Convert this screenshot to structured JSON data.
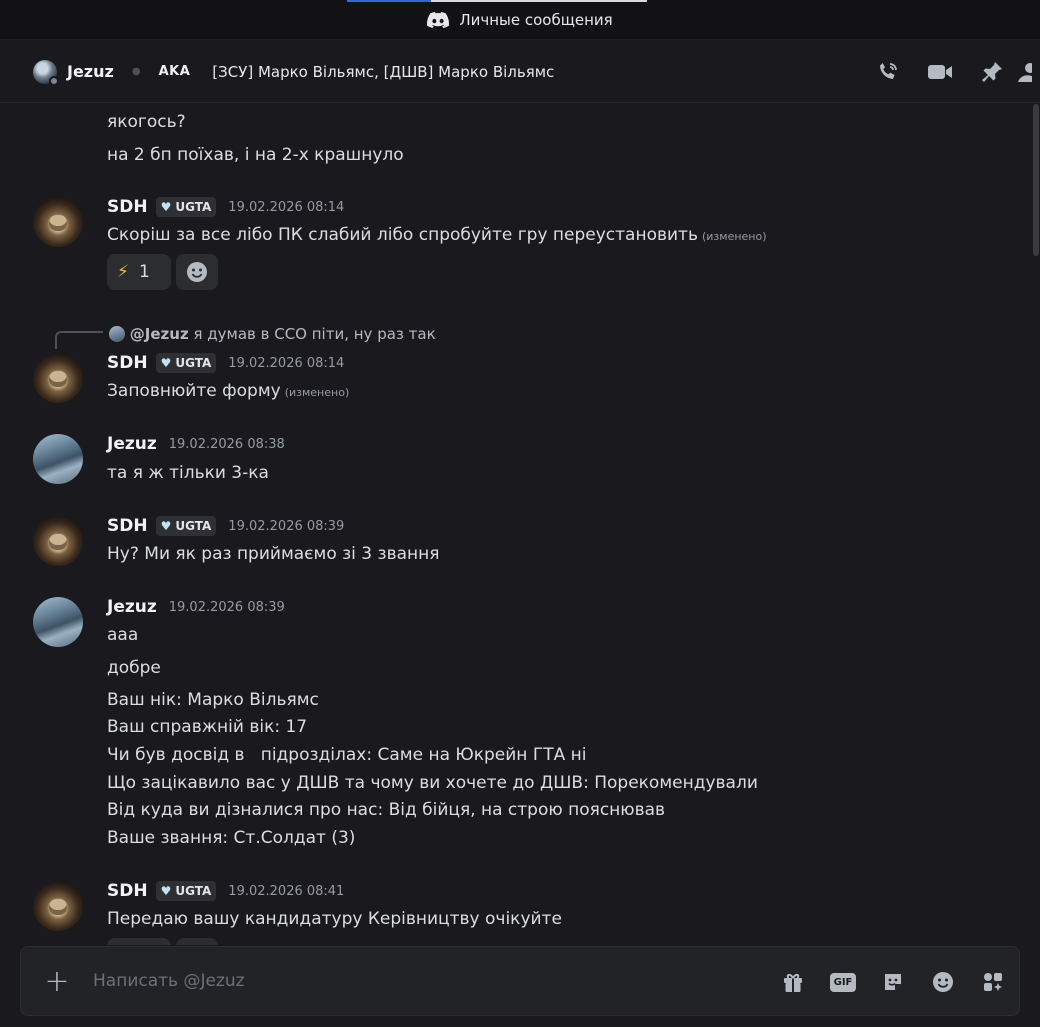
{
  "window": {
    "title": "Личные сообщения"
  },
  "header": {
    "username": "Jezuz",
    "aka_label": "AKA",
    "aka_names": "[ЗСУ] Марко Вільямс, [ДШВ] Марко Вільямс"
  },
  "messages": {
    "m0": {
      "lines": [
        "якогось?",
        "на 2 бп поїхав, і на 2-х крашнуло"
      ]
    },
    "m1": {
      "author": "SDH",
      "badge": "UGTA",
      "time": "19.02.2026 08:14",
      "text": "Скоріш за все лібо ПК слабий лібо спробуйте гру переустановить",
      "edited": "(изменено)",
      "reaction_emoji": "⚡",
      "reaction_count": "1"
    },
    "m2": {
      "reply_mention": "@Jezuz",
      "reply_text": "я думав в ССО піти, ну раз так",
      "author": "SDH",
      "badge": "UGTA",
      "time": "19.02.2026 08:14",
      "text": "Заповнюйте форму",
      "edited": "(изменено)"
    },
    "m3": {
      "author": "Jezuz",
      "time": "19.02.2026 08:38",
      "text": "та я ж тільки 3-ка"
    },
    "m4": {
      "author": "SDH",
      "badge": "UGTA",
      "time": "19.02.2026 08:39",
      "text": "Ну? Ми як раз приймаємо зі 3 звання"
    },
    "m5": {
      "author": "Jezuz",
      "time": "19.02.2026 08:39",
      "lines": [
        "ааа",
        "добре"
      ],
      "form": [
        "Ваш нік: Марко Вільямс",
        "Ваш справжній вік: 17",
        "Чи був досвід в   підрозділах: Саме на Юкрейн ГТА ні",
        "Що зацікавило вас у ДШВ та чому ви хочете до ДШВ: Порекомендували",
        "Від куда ви дізналися про нас: Від бійця, на строю пояснював",
        "Ваше звання: Ст.Солдат (3)"
      ]
    },
    "m6": {
      "author": "SDH",
      "badge": "UGTA",
      "time": "19.02.2026 08:41",
      "text": "Передаю вашу кандидатуру Керівництву очікуйте"
    }
  },
  "composer": {
    "placeholder": "Написать @Jezuz"
  },
  "colors": {
    "background": "#1a1a1e",
    "text": "#dbdee1",
    "muted": "#949ba4"
  }
}
